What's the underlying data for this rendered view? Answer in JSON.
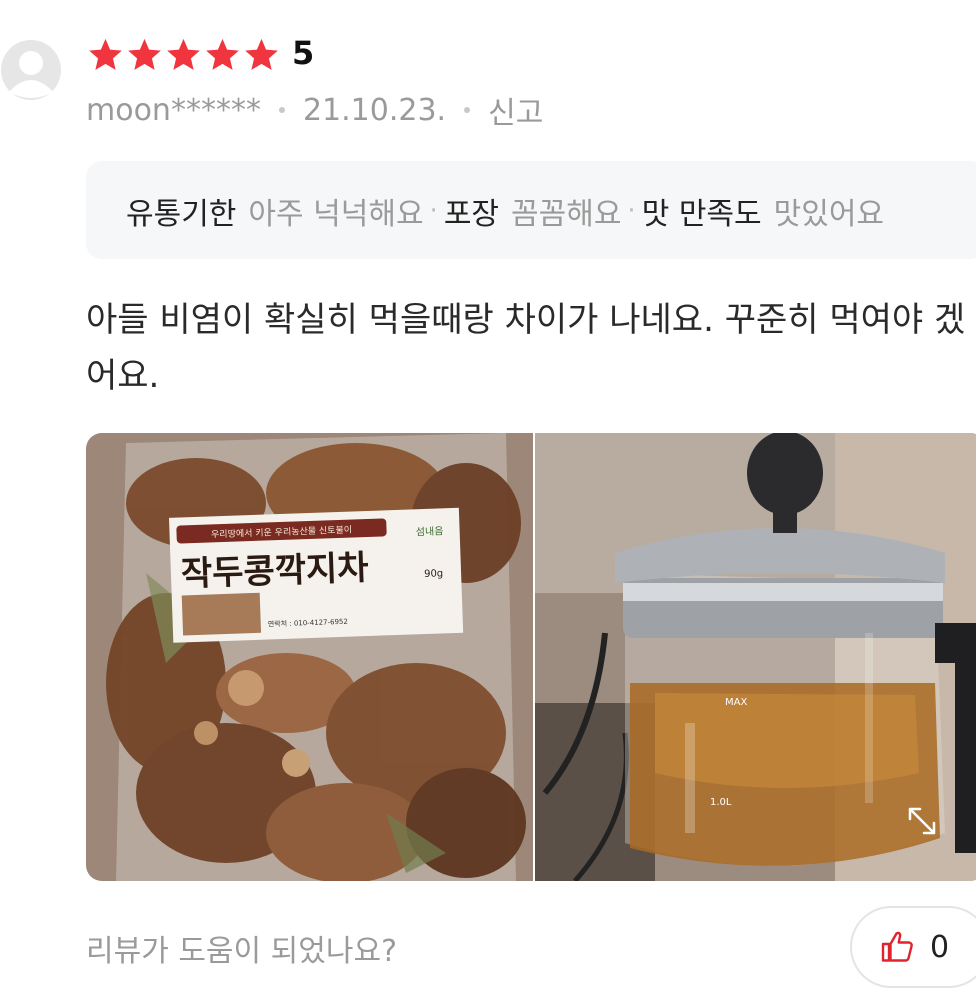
{
  "review": {
    "rating": "5",
    "rating_stars": 5,
    "user": "moon******",
    "date": "21.10.23.",
    "report_label": "신고",
    "tags": [
      {
        "key": "유통기한",
        "value": "아주 넉넉해요"
      },
      {
        "key": "포장",
        "value": "꼼꼼해요"
      },
      {
        "key": "맛 만족도",
        "value": "맛있어요"
      }
    ],
    "text": "아들 비염이 확실히 먹을때랑 차이가 나네요. 꾸준히 먹여야 겠어요.",
    "photo1_label": {
      "top": "우리땅에서 키운 우리농산물 신토불이",
      "brand": "섬내음",
      "title": "작두콩깍지차",
      "weight": "90g",
      "contact": "연락처 : 010-4127-6952"
    },
    "photo2_label": {
      "max": "MAX",
      "level": "1.0L"
    },
    "helpful_question": "리뷰가 도움이 되었나요?",
    "like_count": "0"
  },
  "colors": {
    "star": "#f0353f",
    "muted": "#9a9a9a",
    "tag_bg": "#f6f7f8",
    "like_icon": "#e0242e"
  },
  "icons": [
    "avatar-icon",
    "star-icon",
    "expand-icon",
    "thumbs-up-icon"
  ]
}
